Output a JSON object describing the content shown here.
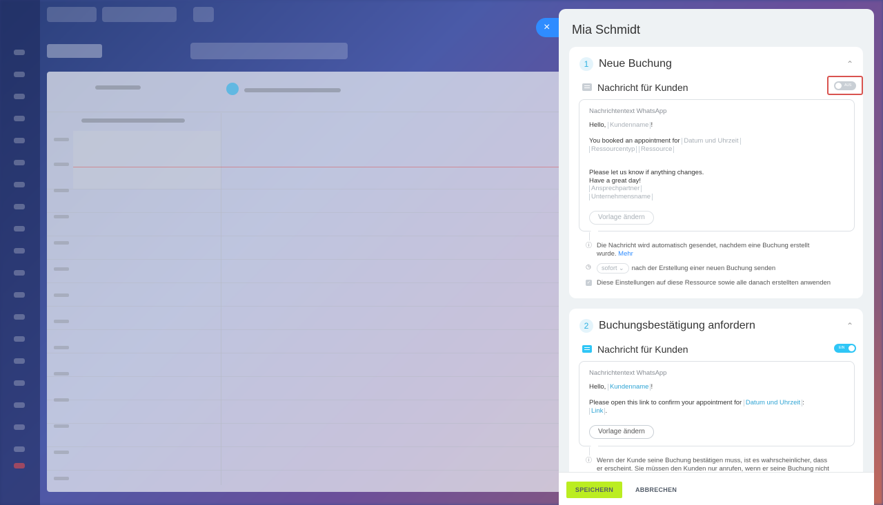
{
  "panel": {
    "title": "Mia Schmidt",
    "close_icon": "×"
  },
  "sections": [
    {
      "number": "1",
      "title": "Neue Buchung",
      "message_label": "Nachricht für Kunden",
      "toggle_state": "AUS",
      "caption": "Nachrichtentext WhatsApp",
      "line_hello": "Hello,",
      "tag_kundenname": "Kundenname",
      "excl": "!",
      "line_booked": "You booked an appointment for",
      "tag_datum": "Datum und Uhrzeit",
      "tag_ressourcentyp": "Ressourcentyp",
      "tag_ressource": "Ressource",
      "line_changes": "Please let us know if anything changes.",
      "line_great_day": "Have a great day!",
      "tag_ansprechpartner": "Ansprechpartner",
      "tag_unternehmensname": "Unternehmensname",
      "template_button": "Vorlage ändern",
      "info_text": "Die Nachricht wird automatisch gesendet, nachdem eine Buchung erstellt",
      "info_text2": "wurde.",
      "info_link": "Mehr",
      "timing_select": "sofort",
      "timing_text": "nach der Erstellung einer neuen Buchung senden",
      "apply_text": "Diese Einstellungen auf diese Ressource sowie alle danach erstellten anwenden"
    },
    {
      "number": "2",
      "title": "Buchungsbestätigung anfordern",
      "message_label": "Nachricht für Kunden",
      "toggle_state": "EIN",
      "caption": "Nachrichtentext WhatsApp",
      "line_hello": "Hello,",
      "tag_kundenname": "Kundenname",
      "excl": "!",
      "line_confirm": "Please open this link to confirm your appointment for",
      "tag_datum": "Datum und Uhrzeit",
      "colon": ":",
      "tag_link": "Link",
      "dot": ".",
      "template_button": "Vorlage ändern",
      "info_text": "Wenn der Kunde seine Buchung bestätigen muss, ist es wahrscheinlicher, dass",
      "info_text2": "er erscheint. Sie müssen den Kunden nur anrufen, wenn er seine Buchung nicht"
    }
  ],
  "footer": {
    "save": "SPEICHERN",
    "cancel": "ABBRECHEN"
  },
  "colors": {
    "accent_blue": "#2f8cff",
    "toggle_on": "#2fc6f6",
    "toggle_off": "#c9cfd5",
    "save_green": "#bbed21",
    "highlight_red": "#d9534f"
  }
}
